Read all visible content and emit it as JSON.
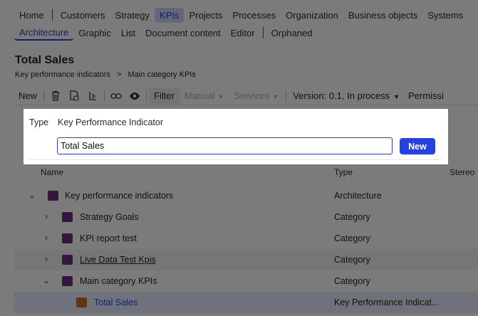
{
  "nav": {
    "main": [
      "Home",
      "Customers",
      "Strategy",
      "KPIs",
      "Projects",
      "Processes",
      "Organization",
      "Business objects",
      "Systems"
    ],
    "sub": [
      "Architecture",
      "Graphic",
      "List",
      "Document content",
      "Editor",
      "Orphaned"
    ]
  },
  "header": {
    "title": "Total Sales",
    "breadcrumb": [
      "Key performance indicators",
      ">",
      "Main category KPIs"
    ]
  },
  "toolbar": {
    "new_label": "New",
    "filter_label": "Filter",
    "manual_label": "Manual",
    "services_label": "Services",
    "version_label": "Version: 0.1, In process",
    "permissions_label": "Permissi"
  },
  "dialog": {
    "type_label": "Type",
    "type_value": "Key Performance Indicator",
    "input_value": "Total Sales",
    "new_button": "New"
  },
  "grid": {
    "col_name": "Name",
    "col_type": "Type",
    "col_stereotype": "Stereo",
    "rows": [
      {
        "name": "Key performance indicators",
        "type": "Architecture",
        "color": "#6b2f7a",
        "expand": "open"
      },
      {
        "name": "Strategy Goals",
        "type": "Category",
        "color": "#6b2f7a",
        "expand": "closed"
      },
      {
        "name": "KPI report test",
        "type": "Category",
        "color": "#6b2f7a",
        "expand": "closed"
      },
      {
        "name": "Live Data Test Kpis",
        "type": "Category",
        "color": "#6b2f7a",
        "expand": "closed"
      },
      {
        "name": "Main category KPIs",
        "type": "Category",
        "color": "#6b2f7a",
        "expand": "open"
      },
      {
        "name": "Total Sales",
        "type": "Key Performance Indicat...",
        "color": "#c66a14",
        "expand": "none"
      }
    ]
  },
  "colors": {
    "accent": "#2a3fd6",
    "category": "#6b2f7a",
    "kpi": "#c66a14"
  }
}
